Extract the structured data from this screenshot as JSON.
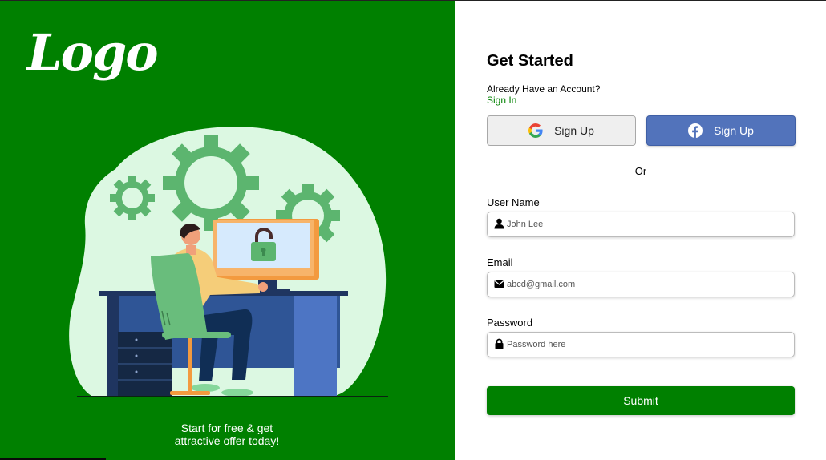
{
  "brand": {
    "logo_text": "Logo"
  },
  "left_panel": {
    "tagline_line1": "Start for free & get",
    "tagline_line2": "attractive offer today!",
    "background_color": "#008000"
  },
  "form": {
    "title": "Get Started",
    "have_account_text": "Already Have an Account?",
    "signin_link": "Sign In",
    "google_signup_label": "Sign Up",
    "facebook_signup_label": "Sign Up",
    "separator_text": "Or",
    "username": {
      "label": "User Name",
      "placeholder": "John Lee",
      "icon": "user-icon"
    },
    "email": {
      "label": "Email",
      "placeholder": "abcd@gmail.com",
      "icon": "envelope-icon"
    },
    "password": {
      "label": "Password",
      "placeholder": "Password here",
      "icon": "lock-icon"
    },
    "submit_label": "Submit",
    "accent_color": "#008000",
    "facebook_color": "#5273bb"
  }
}
